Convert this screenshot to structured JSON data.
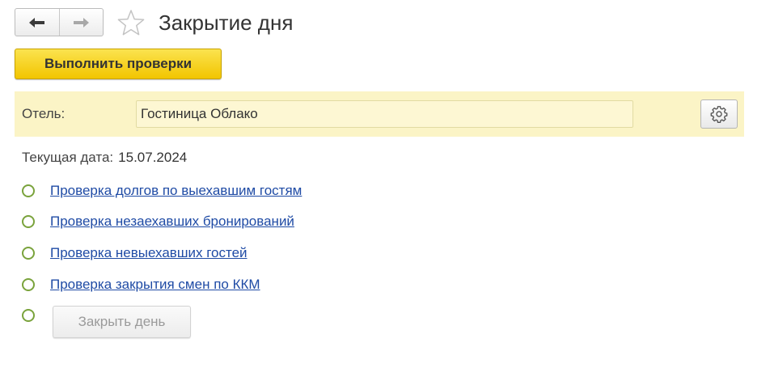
{
  "header": {
    "title": "Закрытие дня",
    "back_icon": "arrow-left-icon",
    "forward_icon": "arrow-right-icon",
    "favorite_icon": "star-icon"
  },
  "toolbar": {
    "run_checks_label": "Выполнить проверки"
  },
  "hotel": {
    "label": "Отель:",
    "value": "Гостиница Облако",
    "settings_icon": "gear-icon"
  },
  "date": {
    "label": "Текущая дата:",
    "value": "15.07.2024"
  },
  "checks": [
    {
      "label": "Проверка долгов по выехавшим гостям"
    },
    {
      "label": "Проверка незаехавших бронирований"
    },
    {
      "label": "Проверка невыехавших гостей"
    },
    {
      "label": "Проверка закрытия смен по ККМ"
    }
  ],
  "close_day": {
    "label": "Закрыть день",
    "enabled": false
  },
  "colors": {
    "accent_yellow": "#f2c500",
    "panel_background": "#fbf4c6",
    "link": "#1f4ba5",
    "status_circle": "#7aa33c"
  }
}
